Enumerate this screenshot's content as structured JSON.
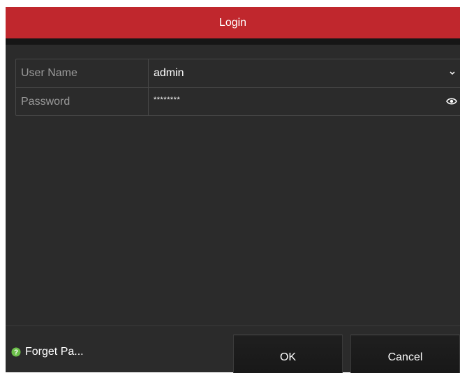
{
  "dialog": {
    "title": "Login"
  },
  "form": {
    "username_label": "User Name",
    "username_value": "admin",
    "password_label": "Password",
    "password_value": "********"
  },
  "footer": {
    "forget_label": "Forget Pa...",
    "ok_label": "OK",
    "cancel_label": "Cancel"
  },
  "icons": {
    "dropdown": "chevron-down-icon",
    "show_password": "eye-icon",
    "help": "help-icon"
  },
  "colors": {
    "title_bar": "#c0272d",
    "background": "#2b2b2b",
    "help_icon": "#6cc04a"
  }
}
